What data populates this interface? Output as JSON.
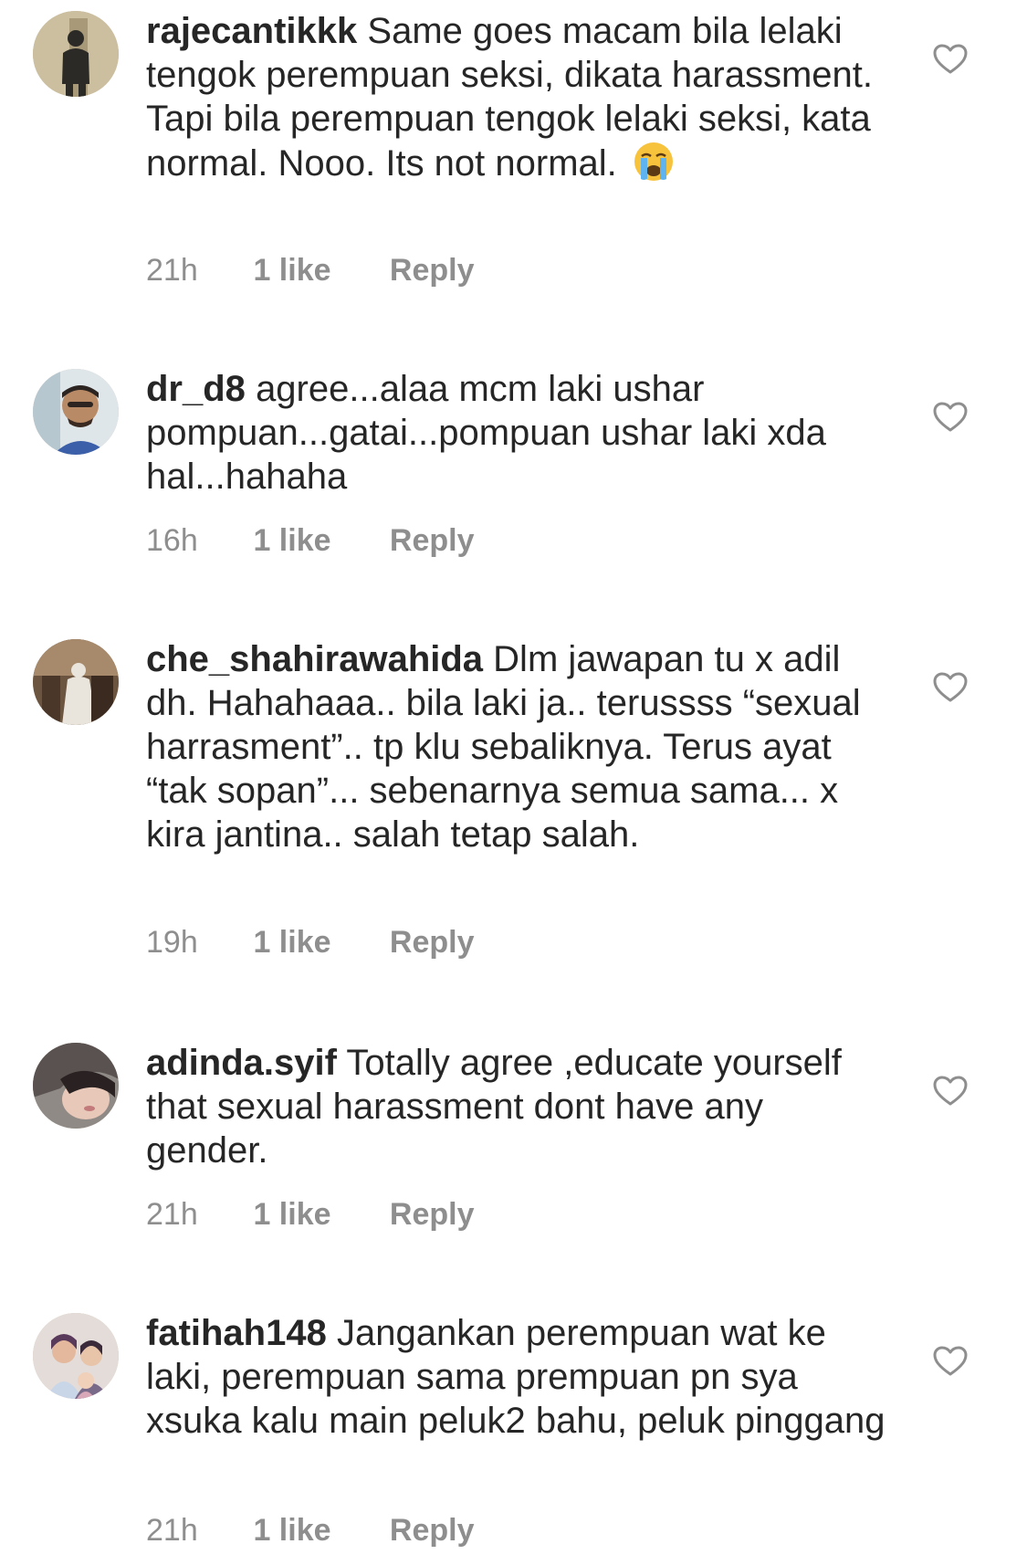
{
  "comments": [
    {
      "username": "rajecantikkk",
      "text": "Same goes macam bila lelaki tengok perempuan seksi, dikata harassment. Tapi bila perempuan tengok lelaki seksi, kata normal. Nooo. Its not normal.",
      "emoji": "loudly-crying-face",
      "time": "21h",
      "likes": "1 like",
      "reply": "Reply"
    },
    {
      "username": "dr_d8",
      "text": "agree...alaa mcm laki ushar pompuan...gatai...pompuan ushar laki xda hal...hahaha",
      "time": "16h",
      "likes": "1 like",
      "reply": "Reply"
    },
    {
      "username": "che_shahirawahida",
      "text": "Dlm jawapan tu x adil dh. Hahahaaa.. bila laki ja.. terussss “sexual harrasment”.. tp klu sebaliknya. Terus ayat “tak sopan”... sebenarnya semua sama... x kira jantina.. salah tetap salah.",
      "time": "19h",
      "likes": "1 like",
      "reply": "Reply"
    },
    {
      "username": "adinda.syif",
      "text": "Totally agree ,educate yourself that sexual harassment dont have any gender.",
      "time": "21h",
      "likes": "1 like",
      "reply": "Reply"
    },
    {
      "username": "fatihah148",
      "text": "Jangankan perempuan wat ke laki, perempuan sama prempuan pn sya xsuka kalu main peluk2 bahu, peluk pinggang",
      "time": "21h",
      "likes": "1 like",
      "reply": "Reply"
    }
  ],
  "icons": {
    "like": "heart-outline-icon",
    "avatar": "avatar-photo"
  },
  "colors": {
    "text": "#262626",
    "meta": "#8e8e8e",
    "heart": "#8e8e8e"
  }
}
